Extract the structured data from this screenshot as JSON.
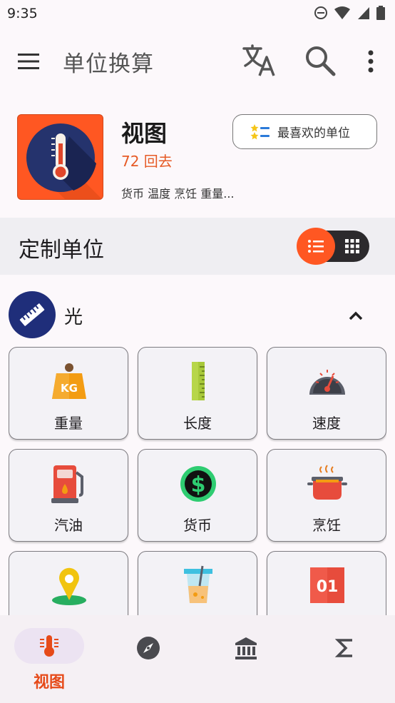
{
  "status": {
    "time": "9:35"
  },
  "app_bar": {
    "title": "单位换算"
  },
  "header": {
    "title": "视图",
    "back": "72 回去",
    "list": "货币 温度 烹饪 重量...",
    "fav_label": "最喜欢的单位"
  },
  "custom": {
    "title": "定制单位"
  },
  "group": {
    "label": "光"
  },
  "tiles": [
    {
      "label": "重量",
      "icon": "weight-kg-icon"
    },
    {
      "label": "长度",
      "icon": "ruler-icon"
    },
    {
      "label": "速度",
      "icon": "speedometer-icon"
    },
    {
      "label": "汽油",
      "icon": "fuel-pump-icon"
    },
    {
      "label": "货币",
      "icon": "dollar-icon"
    },
    {
      "label": "烹饪",
      "icon": "cooking-pot-icon"
    },
    {
      "label": "",
      "icon": "location-pin-icon"
    },
    {
      "label": "",
      "icon": "beaker-icon"
    },
    {
      "label": "",
      "icon": "binary-icon"
    }
  ],
  "bottom_nav": {
    "items": [
      {
        "label": "视图",
        "icon": "thermometer-icon"
      },
      {
        "label": "",
        "icon": "compass-icon"
      },
      {
        "label": "",
        "icon": "bank-icon"
      },
      {
        "label": "",
        "icon": "sigma-icon"
      }
    ]
  },
  "colors": {
    "accent": "#ff5722",
    "accent_text": "#e64a19",
    "dark_blue": "#1f2e7a"
  }
}
